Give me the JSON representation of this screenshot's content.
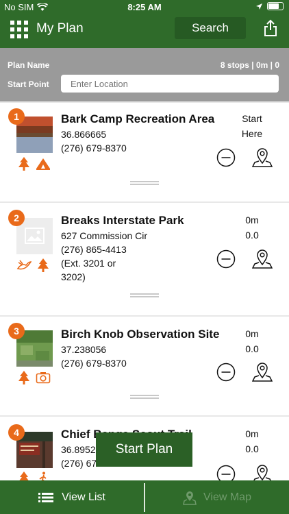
{
  "status_bar": {
    "carrier": "No SIM",
    "time": "8:25 AM"
  },
  "header": {
    "title": "My Plan",
    "search_label": "Search"
  },
  "plan": {
    "name_label": "Plan Name",
    "summary": "8 stops | 0m | 0",
    "start_label": "Start Point",
    "location_placeholder": "Enter Location"
  },
  "stops": [
    {
      "number": "1",
      "name": "Bark Camp Recreation Area",
      "lines": [
        "36.866665",
        "(276) 679-8370"
      ],
      "dist": [
        "Start",
        "Here"
      ],
      "icons": [
        "tree-icon",
        "camping-icon"
      ]
    },
    {
      "number": "2",
      "name": "Breaks Interstate Park",
      "lines": [
        "627 Commission Cir",
        "(276) 865-4413",
        "(Ext. 3201 or",
        "3202)"
      ],
      "dist": [
        "0m",
        "0.0"
      ],
      "icons": [
        "birding-icon",
        "tree-icon"
      ]
    },
    {
      "number": "3",
      "name": "Birch Knob Observation Site",
      "lines": [
        "37.238056",
        "(276) 679-8370"
      ],
      "dist": [
        "0m",
        "0.0"
      ],
      "icons": [
        "tree-icon",
        "camera-icon"
      ]
    },
    {
      "number": "4",
      "name": "Chief Benge Scout Trail",
      "lines": [
        "36.8952",
        "(276) 67"
      ],
      "dist": [
        "0m",
        "0.0"
      ],
      "icons": [
        "tree-icon",
        "hiking-icon"
      ]
    }
  ],
  "start_plan_label": "Start Plan",
  "bottom": {
    "list_label": "View List",
    "map_label": "View Map"
  },
  "colors": {
    "brand_green": "#2f6b2a",
    "accent_orange": "#e96a1a"
  }
}
